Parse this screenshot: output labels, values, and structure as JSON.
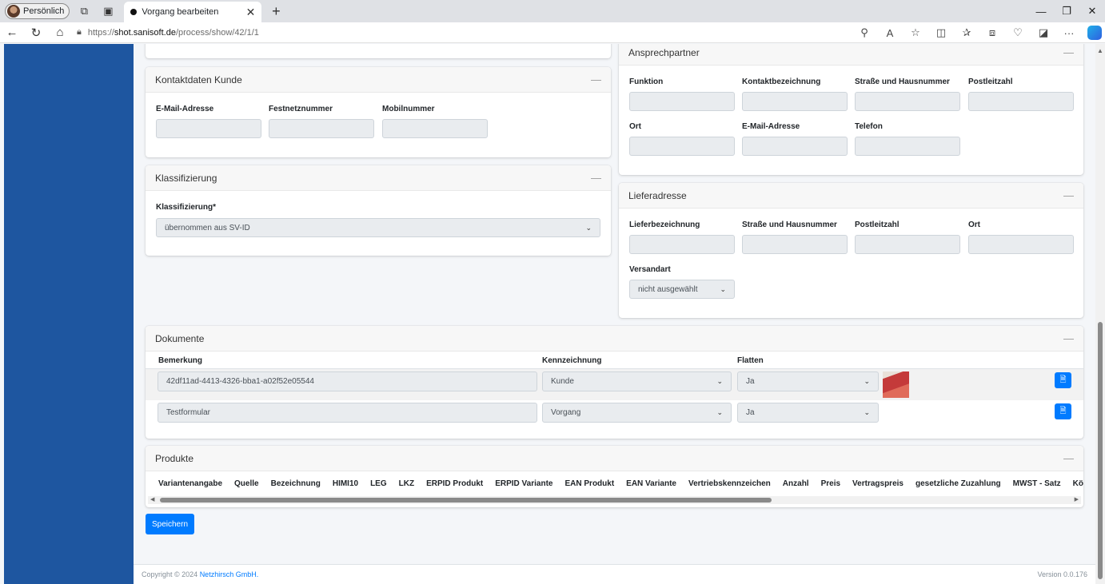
{
  "browser": {
    "profile_label": "Persönlich",
    "tab_title": "Vorgang bearbeiten",
    "url_prefix": "https://",
    "url_host": "shot.sanisoft.de",
    "url_path": "/process/show/42/1/1"
  },
  "contact_customer": {
    "title": "Kontaktdaten Kunde",
    "fields": [
      "E-Mail-Adresse",
      "Festnetznummer",
      "Mobilnummer"
    ]
  },
  "classification": {
    "title": "Klassifizierung",
    "label": "Klassifizierung*",
    "selected": "übernommen aus SV-ID"
  },
  "contact_person": {
    "title": "Ansprechpartner",
    "fields_row1": [
      "Funktion",
      "Kontaktbezeichnung",
      "Straße und Hausnummer",
      "Postleitzahl"
    ],
    "fields_row2": [
      "Ort",
      "E-Mail-Adresse",
      "Telefon"
    ]
  },
  "delivery": {
    "title": "Lieferadresse",
    "fields": [
      "Lieferbezeichnung",
      "Straße und Hausnummer",
      "Postleitzahl",
      "Ort"
    ],
    "shipping_label": "Versandart",
    "shipping_selected": "nicht ausgewählt"
  },
  "documents": {
    "title": "Dokumente",
    "columns": [
      "Bemerkung",
      "Kennzeichnung",
      "Flatten"
    ],
    "rows": [
      {
        "remark": "42df11ad-4413-4326-bba1-a02f52e05544",
        "marking": "Kunde",
        "flatten": "Ja"
      },
      {
        "remark": "Testformular",
        "marking": "Vorgang",
        "flatten": "Ja"
      }
    ]
  },
  "products": {
    "title": "Produkte",
    "columns": [
      "Variantenangabe",
      "Quelle",
      "Bezeichnung",
      "HIMI10",
      "LEG",
      "LKZ",
      "ERPID Produkt",
      "ERPID Variante",
      "EAN Produkt",
      "EAN Variante",
      "Vertriebskennzeichen",
      "Anzahl",
      "Preis",
      "Vertragspreis",
      "gesetzliche Zuzahlung",
      "MWST - Satz",
      "Köstenträger Nu"
    ]
  },
  "save_label": "Speichern",
  "footer": {
    "copyright": "Copyright © 2024",
    "company": "Netzhirsch GmbH.",
    "version": "Version 0.0.176"
  }
}
